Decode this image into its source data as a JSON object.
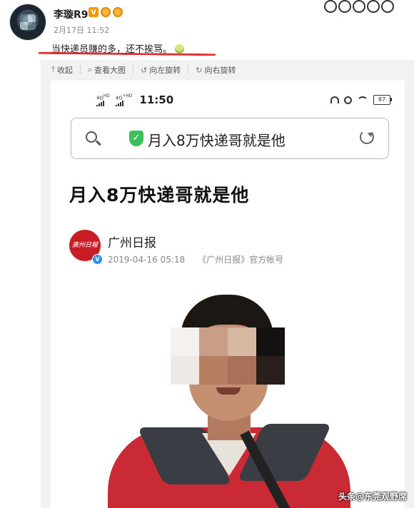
{
  "post": {
    "author": "李璇R9",
    "verified_badge": "V",
    "date": "2月17日 11:52",
    "text": "当快递员赚的多，还不挨骂。"
  },
  "toolbar": {
    "collapse": "收起",
    "view_large": "查看大图",
    "rotate_left": "向左旋转",
    "rotate_right": "向右旋转"
  },
  "embedded": {
    "net_top": "4G",
    "net_top_sup": "HD",
    "net_top2": "4G",
    "net_top2_sup": "+HD",
    "time": "11:50",
    "battery": "87",
    "search_text": "月入8万快递哥就是他",
    "headline": "月入8万快递哥就是他",
    "publisher": "广州日报",
    "publish_time": "2019-04-16 05:18",
    "publish_account": "《广州日报》官方帐号",
    "logo_text": "廣州日報"
  },
  "watermark": "头条@东莞观野席",
  "colors": {
    "underline": "#e8282b",
    "shield": "#3fbf5b",
    "jacket": "#c92a34"
  }
}
